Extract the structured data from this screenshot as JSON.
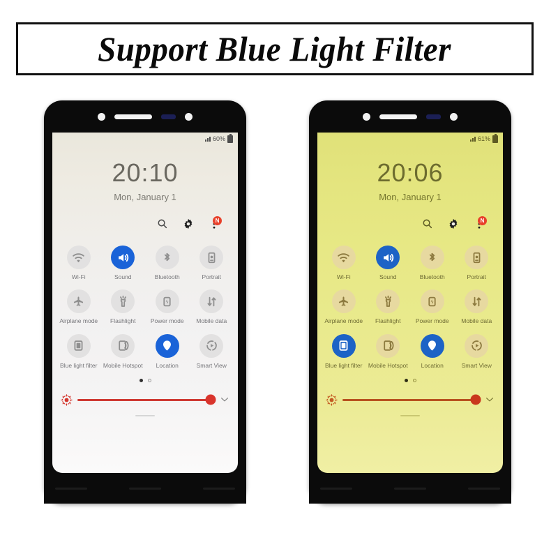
{
  "banner": {
    "title": "Support Blue Light Filter"
  },
  "phones": [
    {
      "id": "phone-normal",
      "status": {
        "battery": "60%",
        "signal_icon": "signal-bars-icon",
        "battery_icon": "battery-icon"
      },
      "clock": {
        "time": "20:10",
        "date": "Mon, January 1"
      },
      "header_icons": [
        {
          "name": "search-icon",
          "label": "Search"
        },
        {
          "name": "gear-icon",
          "label": "Settings"
        },
        {
          "name": "more-options-icon",
          "label": "More options",
          "badge": "N"
        }
      ],
      "toggles": [
        {
          "label": "Wi-Fi",
          "icon": "wifi-icon",
          "state": "off"
        },
        {
          "label": "Sound",
          "icon": "sound-icon",
          "state": "on"
        },
        {
          "label": "Bluetooth",
          "icon": "bluetooth-icon",
          "state": "off"
        },
        {
          "label": "Portrait",
          "icon": "portrait-rotation-icon",
          "state": "off"
        },
        {
          "label": "Airplane mode",
          "icon": "airplane-icon",
          "state": "off"
        },
        {
          "label": "Flashlight",
          "icon": "flashlight-icon",
          "state": "off"
        },
        {
          "label": "Power mode",
          "icon": "power-mode-icon",
          "state": "off"
        },
        {
          "label": "Mobile data",
          "icon": "mobile-data-icon",
          "state": "off"
        },
        {
          "label": "Blue light filter",
          "icon": "blue-light-filter-icon",
          "state": "off"
        },
        {
          "label": "Mobile Hotspot",
          "icon": "mobile-hotspot-icon",
          "state": "off"
        },
        {
          "label": "Location",
          "icon": "location-pin-icon",
          "state": "on"
        },
        {
          "label": "Smart View",
          "icon": "smart-view-icon",
          "state": "off"
        }
      ],
      "page_dots": [
        "filled",
        "empty"
      ],
      "brightness": {
        "icon": "brightness-sun-icon",
        "value_percent": 93,
        "expand_icon": "chevron-down-icon"
      }
    },
    {
      "id": "phone-filtered",
      "status": {
        "battery": "61%",
        "signal_icon": "signal-bars-icon",
        "battery_icon": "battery-icon"
      },
      "clock": {
        "time": "20:06",
        "date": "Mon, January 1"
      },
      "header_icons": [
        {
          "name": "search-icon",
          "label": "Search"
        },
        {
          "name": "gear-icon",
          "label": "Settings"
        },
        {
          "name": "more-options-icon",
          "label": "More options",
          "badge": "N"
        }
      ],
      "toggles": [
        {
          "label": "Wi-Fi",
          "icon": "wifi-icon",
          "state": "off"
        },
        {
          "label": "Sound",
          "icon": "sound-icon",
          "state": "on"
        },
        {
          "label": "Bluetooth",
          "icon": "bluetooth-icon",
          "state": "off"
        },
        {
          "label": "Portrait",
          "icon": "portrait-rotation-icon",
          "state": "off"
        },
        {
          "label": "Airplane mode",
          "icon": "airplane-icon",
          "state": "off"
        },
        {
          "label": "Flashlight",
          "icon": "flashlight-icon",
          "state": "off"
        },
        {
          "label": "Power mode",
          "icon": "power-mode-icon",
          "state": "off"
        },
        {
          "label": "Mobile data",
          "icon": "mobile-data-icon",
          "state": "off"
        },
        {
          "label": "Blue light filter",
          "icon": "blue-light-filter-icon",
          "state": "on"
        },
        {
          "label": "Mobile Hotspot",
          "icon": "mobile-hotspot-icon",
          "state": "off"
        },
        {
          "label": "Location",
          "icon": "location-pin-icon",
          "state": "on"
        },
        {
          "label": "Smart View",
          "icon": "smart-view-icon",
          "state": "off"
        }
      ],
      "page_dots": [
        "filled",
        "empty"
      ],
      "brightness": {
        "icon": "brightness-sun-icon",
        "value_percent": 93,
        "expand_icon": "chevron-down-icon"
      }
    }
  ],
  "colors": {
    "accent_on": "#1a63d8",
    "badge": "#e8402a",
    "slider": "#d9342c",
    "screen_normal": "#eeebe2",
    "screen_filtered": "#e4e57f"
  }
}
